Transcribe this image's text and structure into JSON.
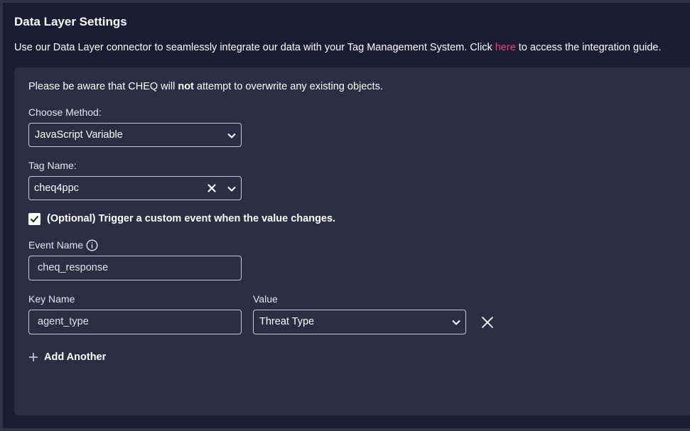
{
  "header": {
    "title": "Data Layer Settings",
    "intro_before": "Use our Data Layer connector to seamlessly integrate our data with your Tag Management System. Click ",
    "intro_link": "here",
    "intro_after": " to access the integration guide."
  },
  "panel": {
    "notice_before": "Please be aware that CHEQ will ",
    "notice_bold": "not",
    "notice_after": " attempt to overwrite any existing objects.",
    "method": {
      "label": "Choose Method:",
      "value": "JavaScript Variable"
    },
    "tag": {
      "label": "Tag Name:",
      "value": "cheq4ppc"
    },
    "custom_event": {
      "checked": true,
      "label": "(Optional) Trigger a custom event when the value changes."
    },
    "event_name": {
      "label": "Event Name",
      "value": "cheq_response"
    },
    "key_name": {
      "label": "Key Name",
      "value": "agent_type"
    },
    "value_field": {
      "label": "Value",
      "value": "Threat Type"
    },
    "add_another": "Add Another"
  },
  "colors": {
    "background": "#1b1c32",
    "panel": "#2b2d42",
    "link": "#e8407a",
    "border": "#c7c9d6"
  },
  "icons": [
    "chevron-down-icon",
    "clear-x-icon",
    "checkbox-checked-icon",
    "info-icon",
    "close-icon",
    "plus-icon"
  ]
}
